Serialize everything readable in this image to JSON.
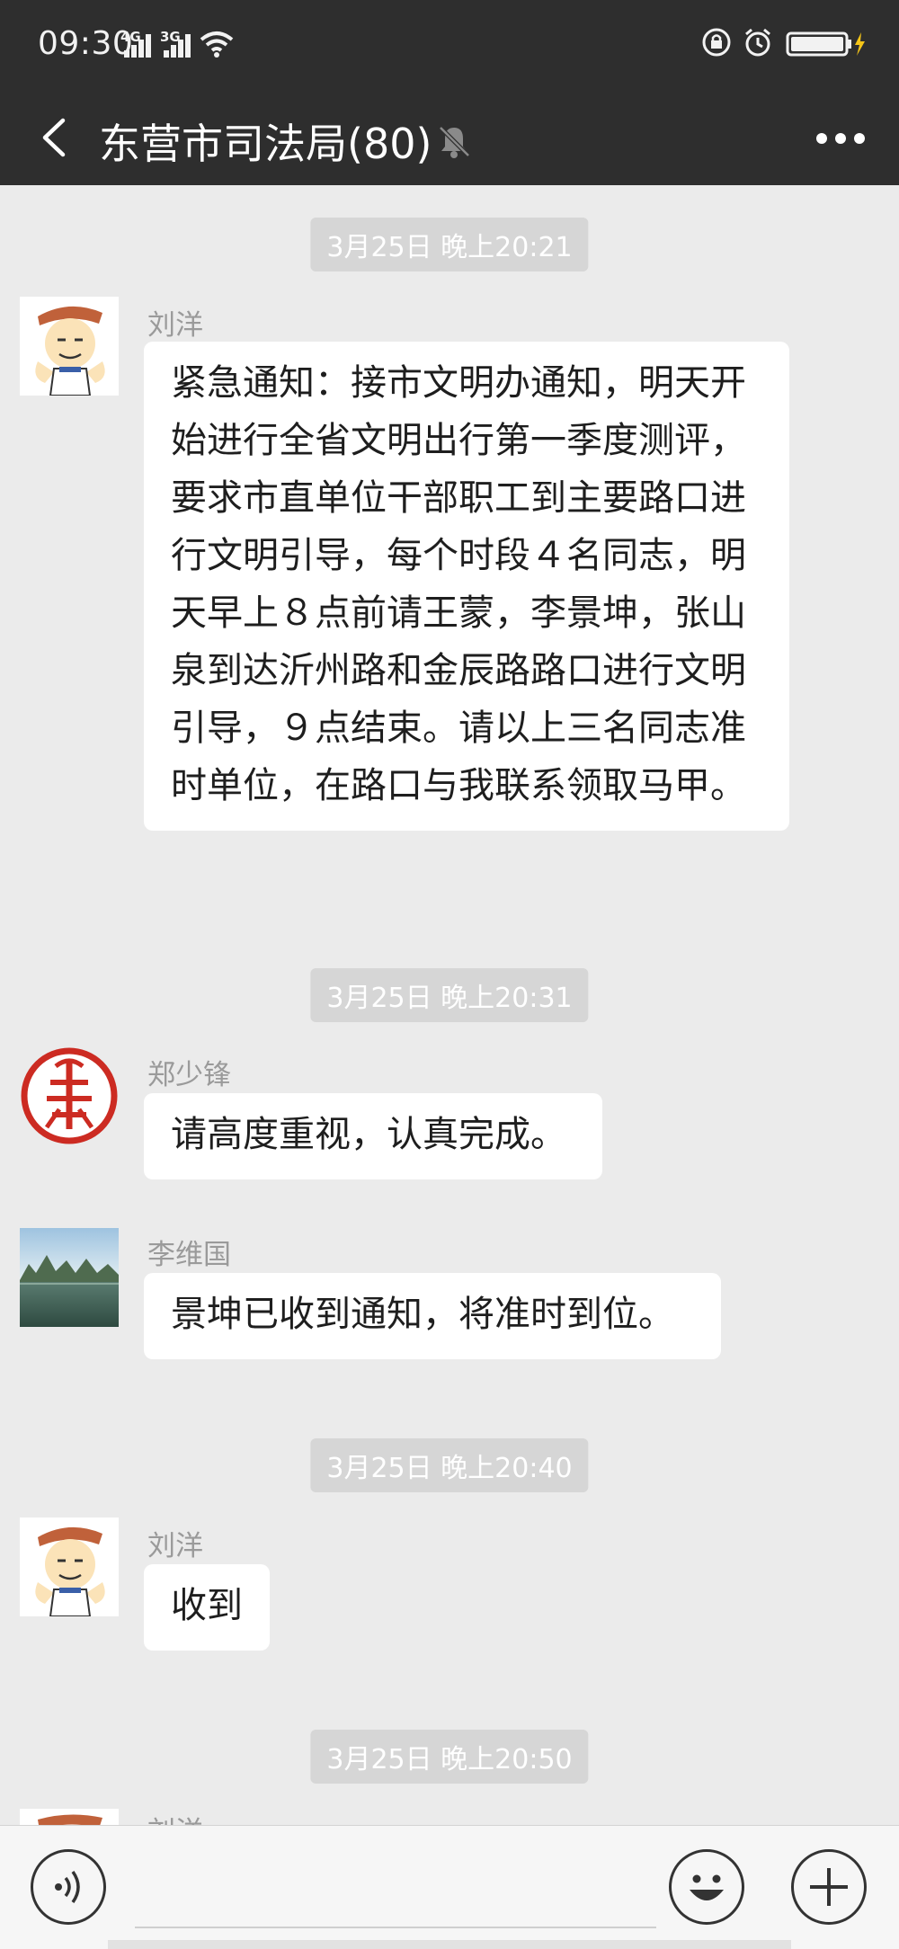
{
  "status": {
    "time": "09:30",
    "net1": "4G",
    "net2": "3G"
  },
  "nav": {
    "title": "东营市司法局(80)"
  },
  "messages": [
    {
      "timestamp": "3月25日 晚上20:21",
      "sender": "刘洋",
      "text": "紧急通知：接市文明办通知，明天开始进行全省文明出行第一季度测评，要求市直单位干部职工到主要路口进行文明引导，每个时段４名同志，明天早上８点前请王蒙，李景坤，张山泉到达沂州路和金辰路路口进行文明引导，９点结束。请以上三名同志准时单位，在路口与我联系领取马甲。"
    },
    {
      "timestamp": "3月25日 晚上20:31",
      "sender": "郑少锋",
      "text": "请高度重视，认真完成。"
    },
    {
      "sender": "李维国",
      "text": "景坤已收到通知，将准时到位。"
    },
    {
      "timestamp": "3月25日 晚上20:40",
      "sender": "刘洋",
      "text": "收到"
    },
    {
      "timestamp": "3月25日 晚上20:50",
      "sender": "刘洋"
    }
  ],
  "icons": {
    "back": "chevron-left-icon",
    "mute": "bell-off-icon",
    "more": "more-dots-icon",
    "voice": "voice-icon",
    "emoji": "emoji-icon",
    "plus": "plus-icon"
  },
  "colors": {
    "bar": "#2e2e2e",
    "background": "#ebebeb",
    "bubble": "#ffffff",
    "timestamp_bg": "#d6d6d6"
  }
}
